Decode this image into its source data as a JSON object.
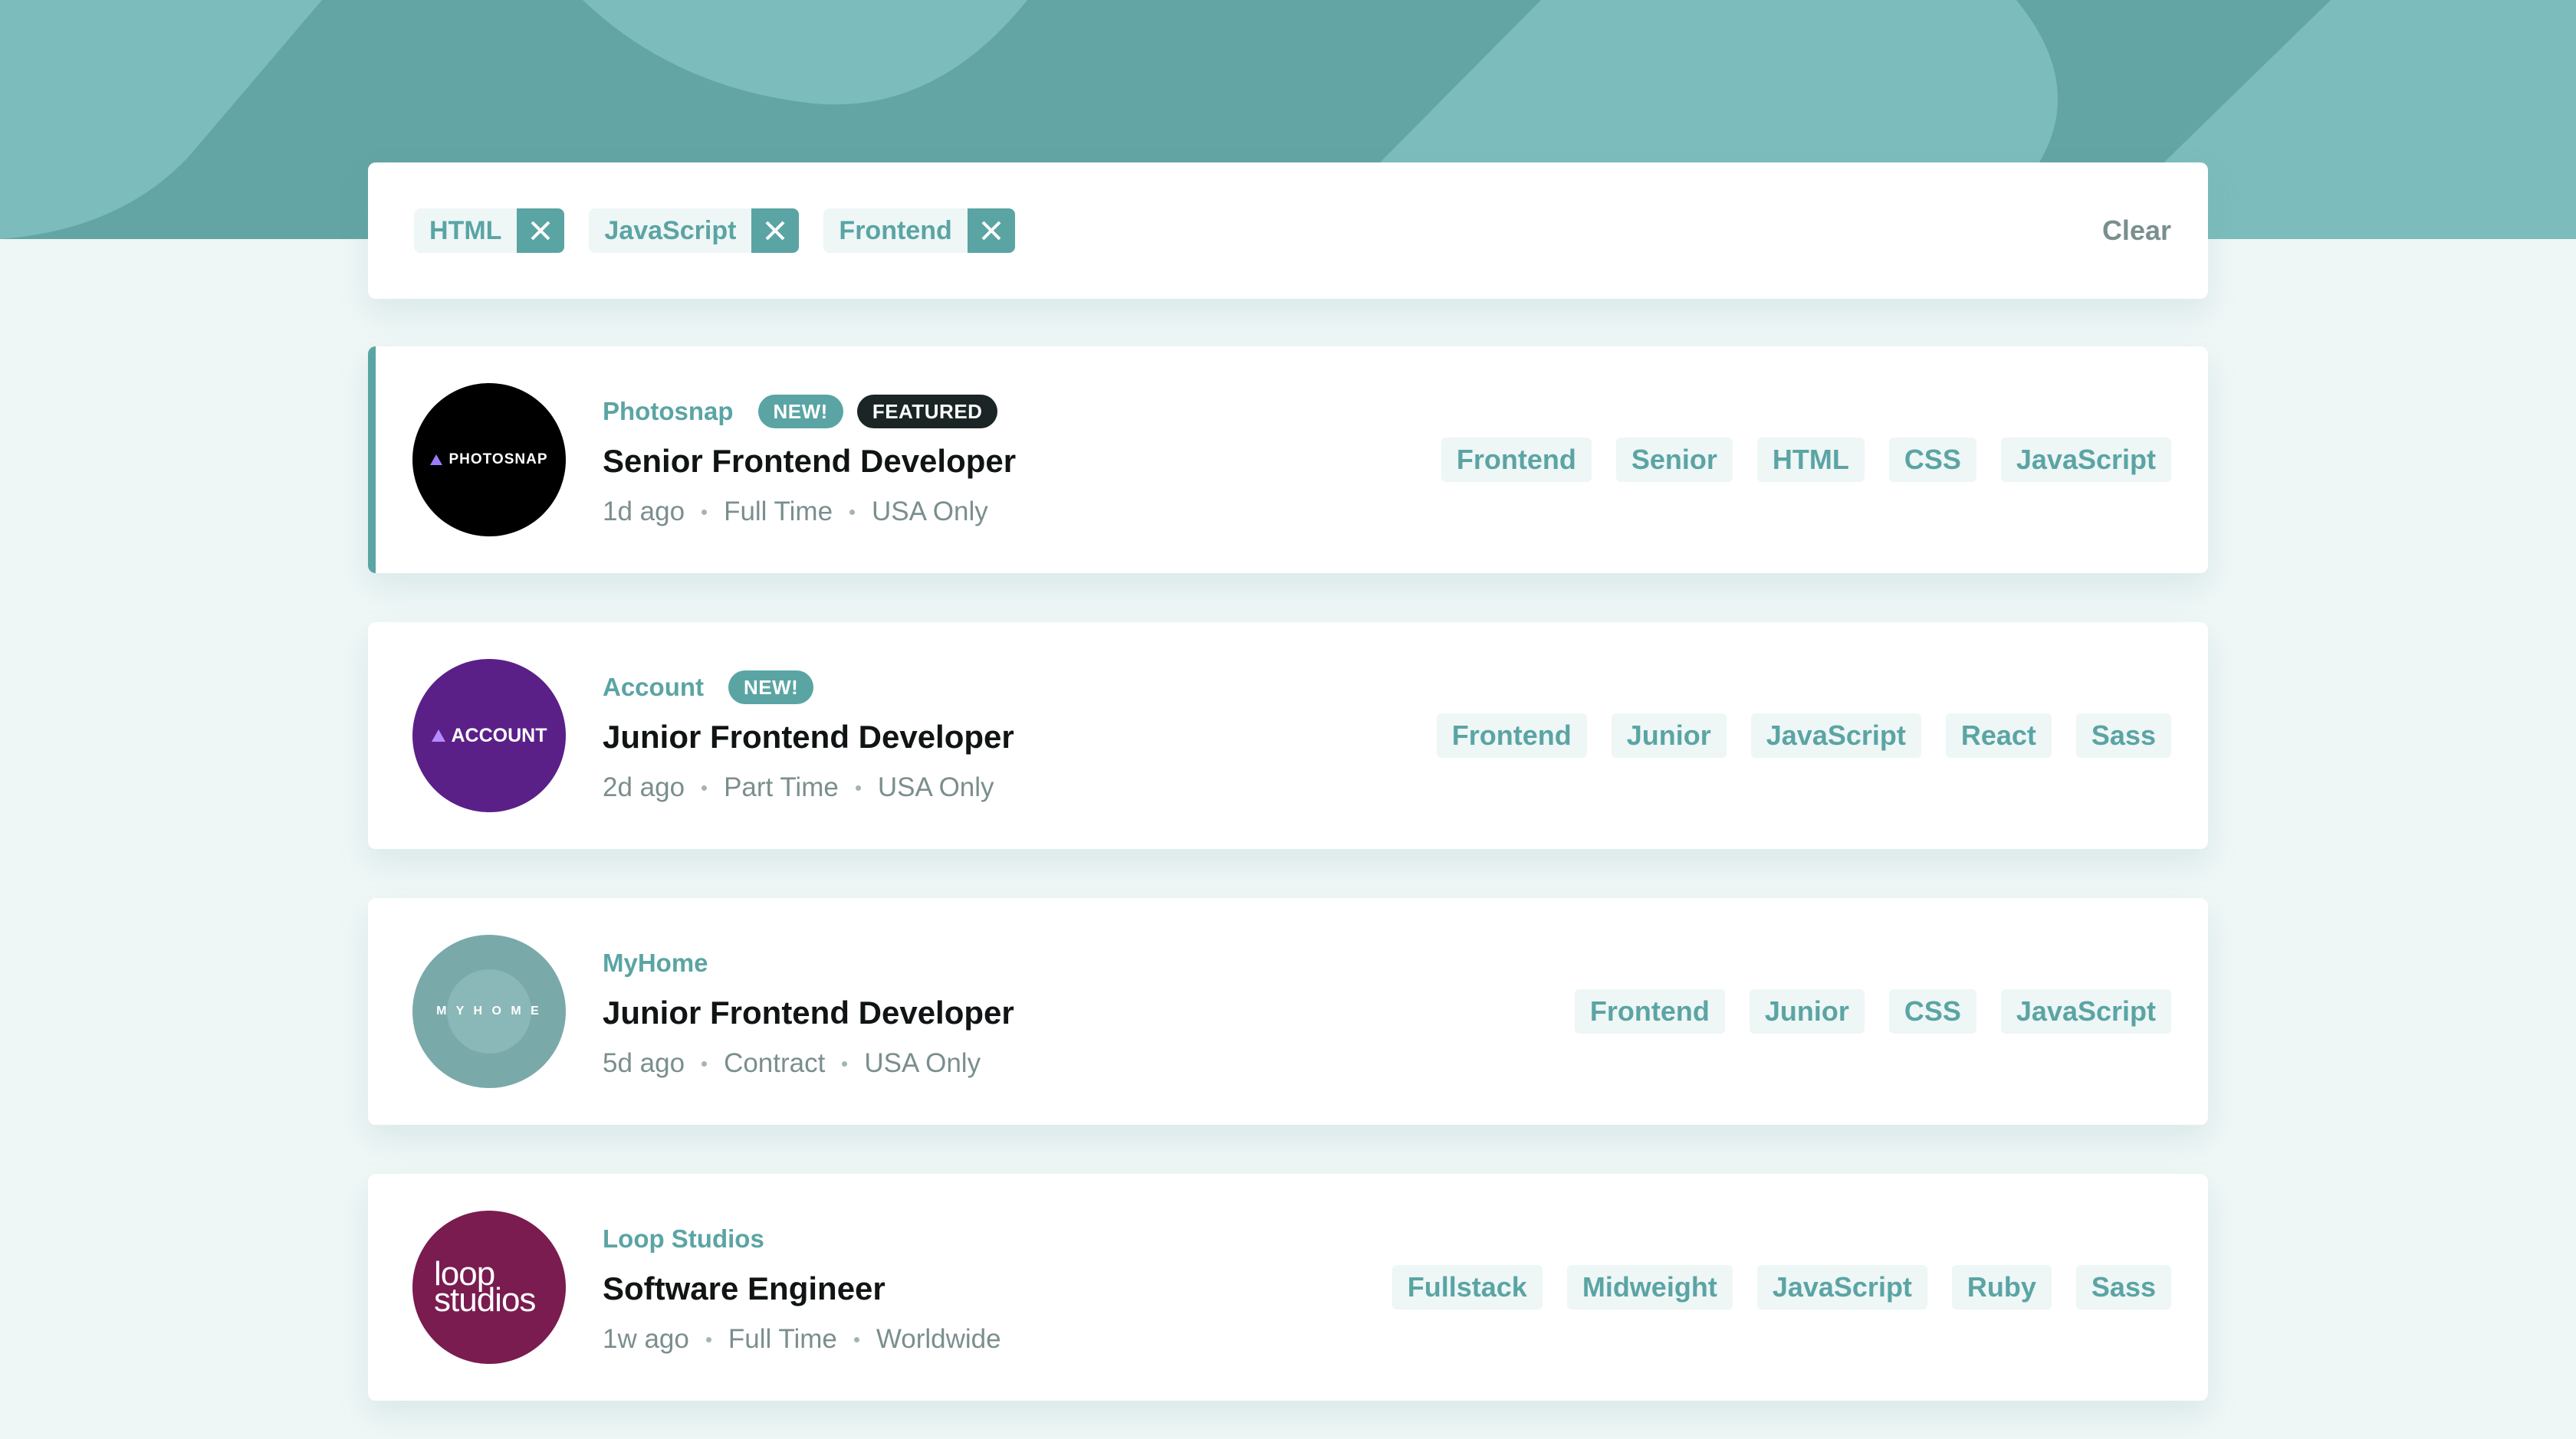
{
  "filters": {
    "chips": [
      {
        "label": "HTML"
      },
      {
        "label": "JavaScript"
      },
      {
        "label": "Frontend"
      }
    ],
    "clear_label": "Clear"
  },
  "jobs": [
    {
      "company": "Photosnap",
      "logo_text": "PHOTOSNAP",
      "new_label": "NEW!",
      "featured_label": "FEATURED",
      "position": "Senior Frontend Developer",
      "posted": "1d ago",
      "contract": "Full Time",
      "location": "USA Only",
      "tags": [
        "Frontend",
        "Senior",
        "HTML",
        "CSS",
        "JavaScript"
      ]
    },
    {
      "company": "Account",
      "logo_text": "ACCOUNT",
      "new_label": "NEW!",
      "position": "Junior Frontend Developer",
      "posted": "2d ago",
      "contract": "Part Time",
      "location": "USA Only",
      "tags": [
        "Frontend",
        "Junior",
        "JavaScript",
        "React",
        "Sass"
      ]
    },
    {
      "company": "MyHome",
      "logo_text": "M Y H O M E",
      "position": "Junior Frontend Developer",
      "posted": "5d ago",
      "contract": "Contract",
      "location": "USA Only",
      "tags": [
        "Frontend",
        "Junior",
        "CSS",
        "JavaScript"
      ]
    },
    {
      "company": "Loop Studios",
      "logo_text_line1": "loop",
      "logo_text_line2": "studios",
      "position": "Software Engineer",
      "posted": "1w ago",
      "contract": "Full Time",
      "location": "Worldwide",
      "tags": [
        "Fullstack",
        "Midweight",
        "JavaScript",
        "Ruby",
        "Sass"
      ]
    }
  ],
  "colors": {
    "accent": "#5ba4a4",
    "background": "#eff6f6",
    "header": "#63a4a4",
    "featured_badge": "#1b2525"
  }
}
